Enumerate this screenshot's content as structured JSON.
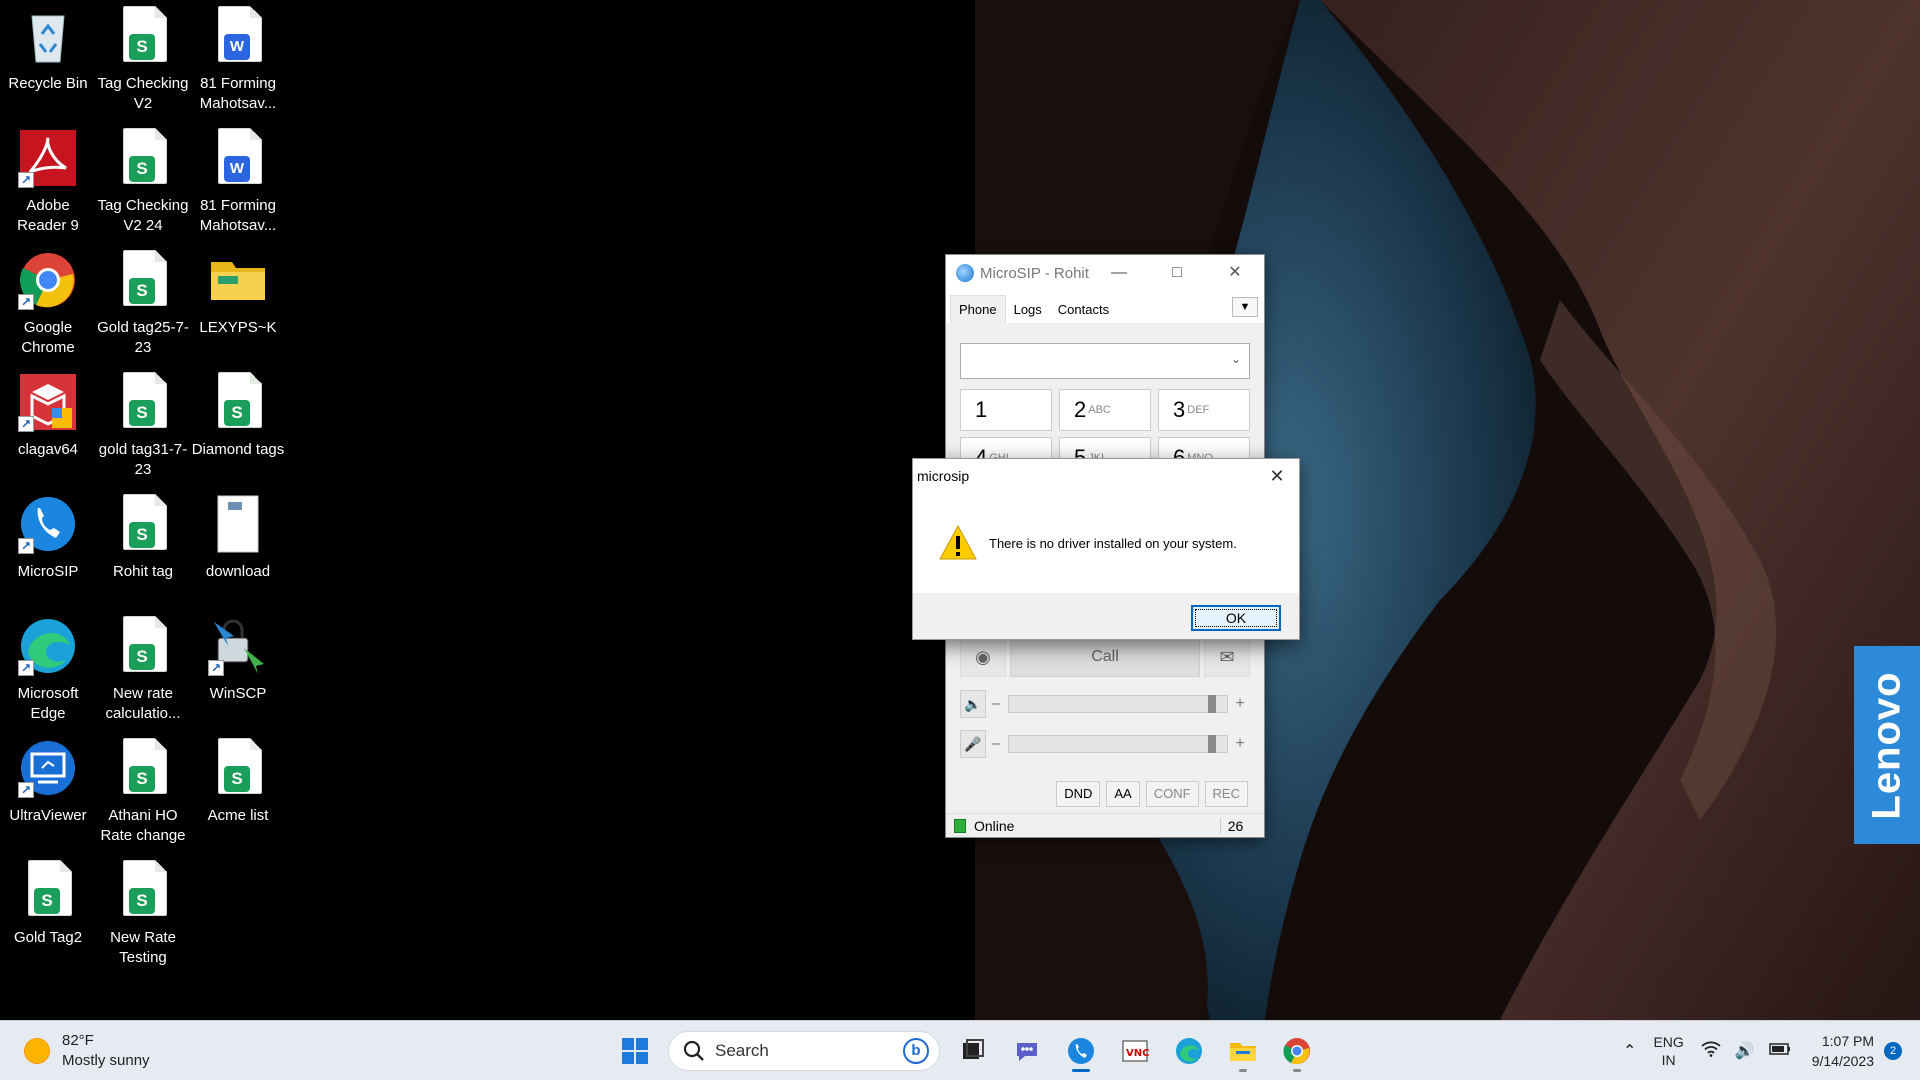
{
  "desktop": {
    "icons": [
      {
        "label": "Recycle Bin",
        "icon": "recycle-bin-icon"
      },
      {
        "label": "Tag Checking V2",
        "icon": "spreadsheet-file-icon"
      },
      {
        "label": "81 Forming Mahotsav...",
        "icon": "word-document-icon"
      },
      {
        "label": "Adobe Reader 9",
        "icon": "adobe-reader-icon"
      },
      {
        "label": "Tag Checking V2 24",
        "icon": "spreadsheet-file-icon"
      },
      {
        "label": "81 Forming Mahotsav...",
        "icon": "word-document-icon"
      },
      {
        "label": "Google Chrome",
        "icon": "chrome-icon"
      },
      {
        "label": "Gold tag25-7-23",
        "icon": "spreadsheet-file-icon"
      },
      {
        "label": "LEXYPS~K",
        "icon": "folder-icon"
      },
      {
        "label": "clagav64",
        "icon": "clagav-icon"
      },
      {
        "label": "gold tag31-7-23",
        "icon": "spreadsheet-file-icon"
      },
      {
        "label": "Diamond tags",
        "icon": "spreadsheet-file-icon"
      },
      {
        "label": "MicroSIP",
        "icon": "microsip-icon"
      },
      {
        "label": "Rohit tag",
        "icon": "spreadsheet-file-icon"
      },
      {
        "label": "download",
        "icon": "image-file-icon"
      },
      {
        "label": "Microsoft Edge",
        "icon": "edge-icon"
      },
      {
        "label": "New rate calculatio...",
        "icon": "spreadsheet-file-icon"
      },
      {
        "label": "WinSCP",
        "icon": "winscp-icon"
      },
      {
        "label": "UltraViewer",
        "icon": "ultraviewer-icon"
      },
      {
        "label": "Athani  HO Rate change",
        "icon": "spreadsheet-file-icon"
      },
      {
        "label": "Acme list",
        "icon": "spreadsheet-file-icon"
      },
      {
        "label": "Gold Tag2",
        "icon": "spreadsheet-file-icon"
      },
      {
        "label": "New Rate Testing",
        "icon": "spreadsheet-file-icon"
      }
    ]
  },
  "microsip": {
    "title": "MicroSIP - Rohit",
    "tabs": [
      "Phone",
      "Logs",
      "Contacts"
    ],
    "keys": [
      {
        "digit": "1",
        "letters": ""
      },
      {
        "digit": "2",
        "letters": "ABC"
      },
      {
        "digit": "3",
        "letters": "DEF"
      },
      {
        "digit": "4",
        "letters": "GHI"
      },
      {
        "digit": "5",
        "letters": "JKL"
      },
      {
        "digit": "6",
        "letters": "MNO"
      }
    ],
    "call_label": "Call",
    "options": [
      "DND",
      "AA",
      "CONF",
      "REC"
    ],
    "status": "Online",
    "status_count": "26",
    "speaker_level": 0.95,
    "mic_level": 0.95
  },
  "dialog": {
    "title": "microsip",
    "message": "There is no driver installed on your system.",
    "ok_label": "OK"
  },
  "lenovo": "Lenovo",
  "taskbar": {
    "weather_temp": "82°F",
    "weather_desc": "Mostly sunny",
    "search_placeholder": "Search",
    "lang_top": "ENG",
    "lang_bottom": "IN",
    "time": "1:07 PM",
    "date": "9/14/2023",
    "notifications": "2"
  },
  "colors": {
    "accent": "#0067c0",
    "online": "#2fae3b",
    "lenovo": "#2c8ad8"
  }
}
